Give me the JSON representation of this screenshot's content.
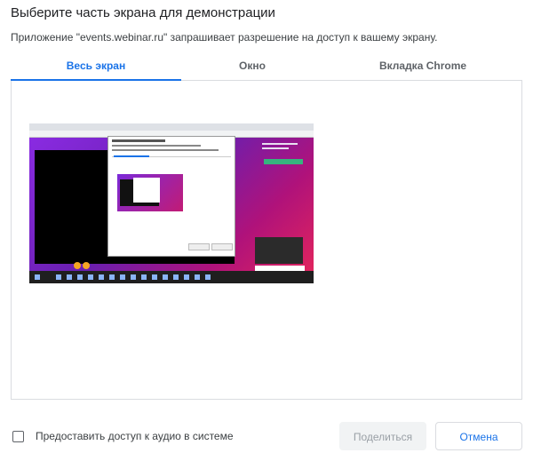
{
  "dialog": {
    "title": "Выберите часть экрана для демонстрации",
    "subtitle": "Приложение \"events.webinar.ru\" запрашивает разрешение на доступ к вашему экрану."
  },
  "tabs": [
    {
      "label": "Весь экран",
      "active": true
    },
    {
      "label": "Окно",
      "active": false
    },
    {
      "label": "Вкладка Chrome",
      "active": false
    }
  ],
  "footer": {
    "audio_checkbox_checked": false,
    "audio_label": "Предоставить доступ к аудио в системе",
    "share_label": "Поделиться",
    "share_enabled": false,
    "cancel_label": "Отмена"
  },
  "colors": {
    "accent": "#1a73e8",
    "disabled_bg": "#f1f3f4",
    "disabled_text": "#9aa0a6",
    "border": "#dadce0"
  }
}
